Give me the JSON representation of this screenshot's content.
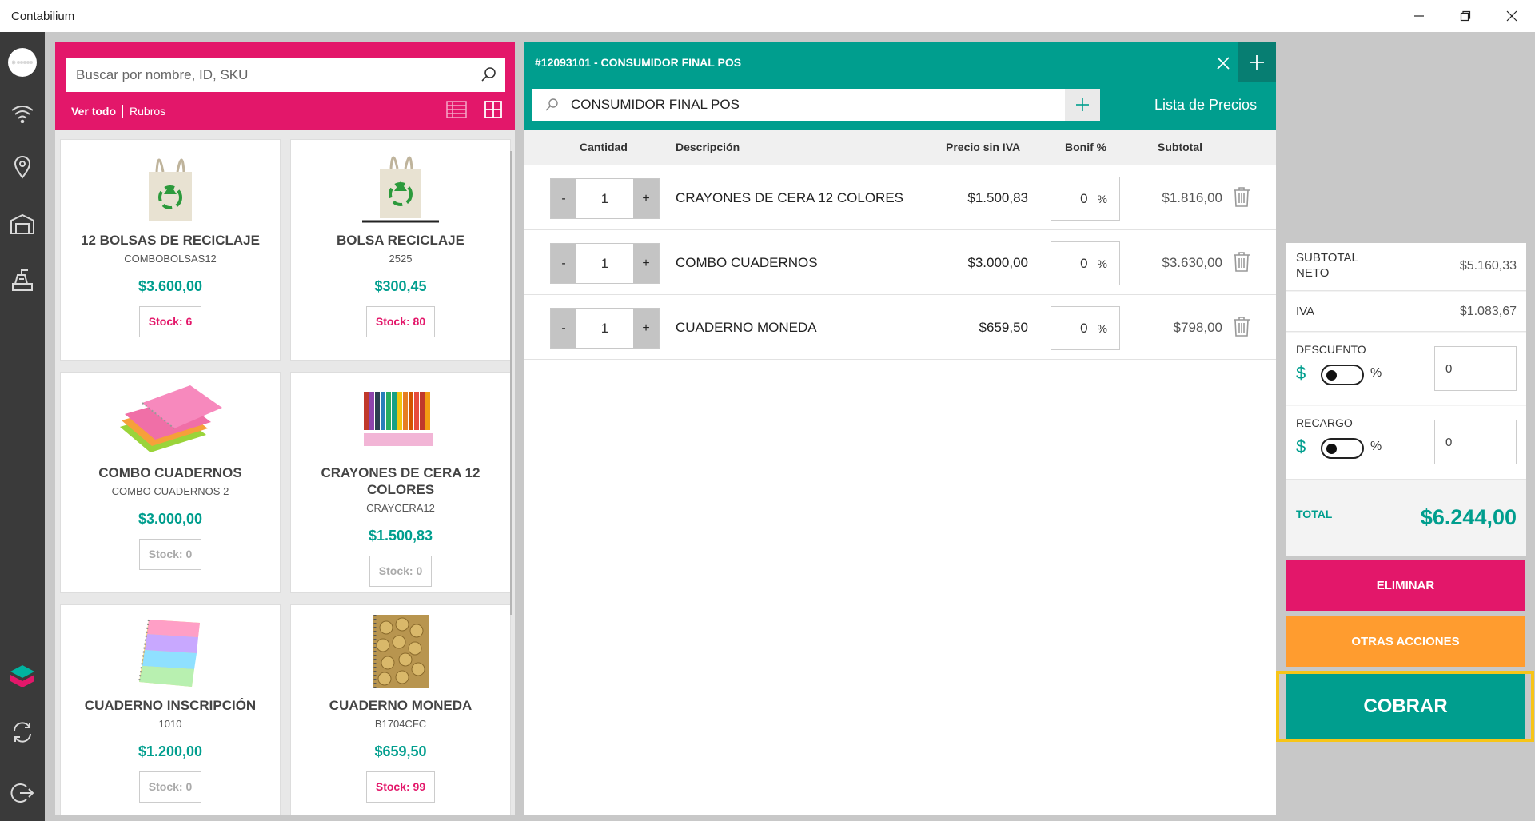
{
  "window": {
    "title": "Contabilium",
    "controls": [
      "minimize",
      "restore",
      "close"
    ]
  },
  "rail": {
    "icons": [
      "logo-icon",
      "wifi-icon",
      "location-icon",
      "warehouse-icon",
      "cash-register-icon",
      "contabilium-logo-icon",
      "sync-icon",
      "logout-icon"
    ]
  },
  "products": {
    "search_placeholder": "Buscar por nombre, ID, SKU",
    "filter_all": "Ver todo",
    "filter_categories": "Rubros",
    "items": [
      {
        "name": "12 BOLSAS DE RECICLAJE",
        "sku": "COMBOBOLSAS12",
        "price": "$3.600,00",
        "stock": "Stock: 6",
        "in_stock": true,
        "image": "recycle-bag-icon"
      },
      {
        "name": "BOLSA RECICLAJE",
        "sku": "2525",
        "price": "$300,45",
        "stock": "Stock: 80",
        "in_stock": true,
        "image": "recycle-bag-icon"
      },
      {
        "name": "COMBO CUADERNOS",
        "sku": "COMBO CUADERNOS 2",
        "price": "$3.000,00",
        "stock": "Stock: 0",
        "in_stock": false,
        "image": "notebooks-icon"
      },
      {
        "name": "CRAYONES DE CERA 12 COLORES",
        "sku": "CRAYCERA12",
        "price": "$1.500,83",
        "stock": "Stock: 0",
        "in_stock": false,
        "image": "crayons-icon"
      },
      {
        "name": "CUADERNO INSCRIPCIÓN",
        "sku": "1010",
        "price": "$1.200,00",
        "stock": "Stock: 0",
        "in_stock": false,
        "image": "notebook-icon"
      },
      {
        "name": "CUADERNO MONEDA",
        "sku": "B1704CFC",
        "price": "$659,50",
        "stock": "Stock: 99",
        "in_stock": true,
        "image": "coin-notebook-icon"
      }
    ]
  },
  "order": {
    "title": "#12093101 - CONSUMIDOR FINAL POS",
    "client": "CONSUMIDOR FINAL POS",
    "price_list": "Lista de Precios",
    "columns": {
      "qty": "Cantidad",
      "desc": "Descripción",
      "price": "Precio sin IVA",
      "bonif": "Bonif %",
      "subtotal": "Subtotal"
    },
    "lines": [
      {
        "qty": "1",
        "desc": "CRAYONES DE CERA 12 COLORES",
        "price": "$1.500,83",
        "bonif": "0",
        "bonif_unit": "%",
        "subtotal": "$1.816,00"
      },
      {
        "qty": "1",
        "desc": "COMBO CUADERNOS",
        "price": "$3.000,00",
        "bonif": "0",
        "bonif_unit": "%",
        "subtotal": "$3.630,00"
      },
      {
        "qty": "1",
        "desc": "CUADERNO MONEDA",
        "price": "$659,50",
        "bonif": "0",
        "bonif_unit": "%",
        "subtotal": "$798,00"
      }
    ],
    "minus": "-",
    "plus": "+"
  },
  "totals": {
    "subtotal_label": "SUBTOTAL NETO",
    "subtotal_value": "$5.160,33",
    "iva_label": "IVA",
    "iva_value": "$1.083,67",
    "discount_label": "DESCUENTO",
    "discount_value": "0",
    "surcharge_label": "RECARGO",
    "surcharge_value": "0",
    "dollar": "$",
    "percent": "%",
    "total_label": "TOTAL",
    "total_value": "$6.244,00"
  },
  "actions": {
    "delete": "ELIMINAR",
    "other": "OTRAS ACCIONES",
    "pay": "COBRAR"
  },
  "colors": {
    "magenta": "#e3176a",
    "teal": "#009e8e",
    "orange": "#ff9c2f",
    "highlight": "#f7c518",
    "rail": "#3a3a3a"
  }
}
